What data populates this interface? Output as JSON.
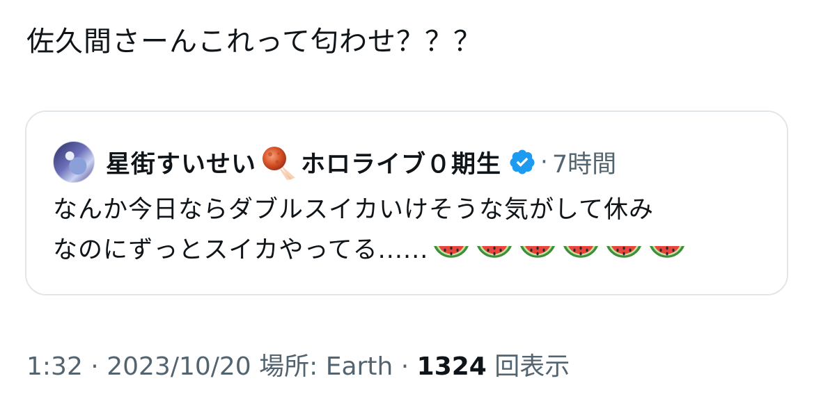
{
  "tweet": {
    "text": "佐久間さーんこれって匂わせ？？？"
  },
  "quote": {
    "display_name": "星街すいせい",
    "display_name_suffix": "ホロライブ０期生",
    "separator": "·",
    "time": "7時間",
    "body_line1": "なんか今日ならダブルスイカいけそうな気がして休み",
    "body_line2": "なのにずっとスイカやってる......",
    "emoji": [
      "watermelon-icon",
      "watermelon-icon",
      "watermelon-icon",
      "watermelon-icon",
      "watermelon-icon",
      "watermelon-icon"
    ]
  },
  "meta": {
    "time": "1:32",
    "sep1": "·",
    "date": "2023/10/20",
    "location_label": "場所: Earth",
    "sep2": "·",
    "views_count": "1324",
    "views_label": "回表示"
  },
  "colors": {
    "text": "#0f1419",
    "secondary": "#536471",
    "verified": "#1d9bf0",
    "border": "#e1e6ea"
  }
}
